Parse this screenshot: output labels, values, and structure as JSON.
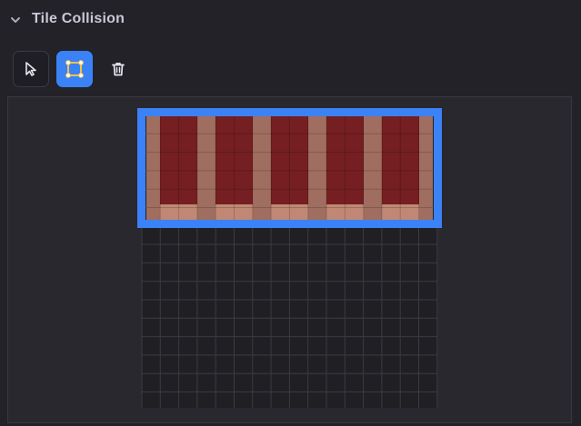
{
  "section": {
    "title": "Tile Collision",
    "collapse_icon": "chevron-down-icon"
  },
  "toolbar": {
    "tools": [
      {
        "name": "select-tool-button",
        "icon": "cursor-arrow-icon",
        "active": false
      },
      {
        "name": "rectangle-tool-button",
        "icon": "rectangle-select-icon",
        "active": true
      },
      {
        "name": "delete-button",
        "icon": "trash-icon",
        "active": false
      }
    ]
  },
  "colors": {
    "panel_bg": "#232228",
    "canvas_bg": "#29282e",
    "grid_bg": "#202024",
    "grid_line": "#3a3a42",
    "accent": "#3b82f6",
    "tile_dark_red": "#751f22",
    "tile_tan": "#a06e60",
    "tile_light_tan": "#c08874"
  }
}
